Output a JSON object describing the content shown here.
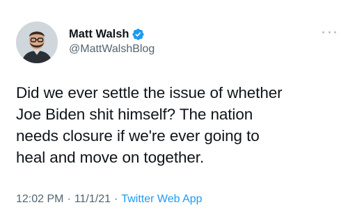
{
  "author": {
    "display_name": "Matt Walsh",
    "handle": "@MattWalshBlog",
    "verified": true,
    "avatar_icon": "profile-photo"
  },
  "tweet": {
    "lines": [
      "Did we ever settle the issue of whether",
      "Joe Biden shit himself? The nation",
      "needs closure if we're ever going to",
      "heal and move on together."
    ]
  },
  "meta": {
    "time": "12:02 PM",
    "date": "11/1/21",
    "separator": "·",
    "source": "Twitter Web App"
  },
  "colors": {
    "text": "#0f1419",
    "secondary": "#536471",
    "accent": "#1d9bf0"
  }
}
